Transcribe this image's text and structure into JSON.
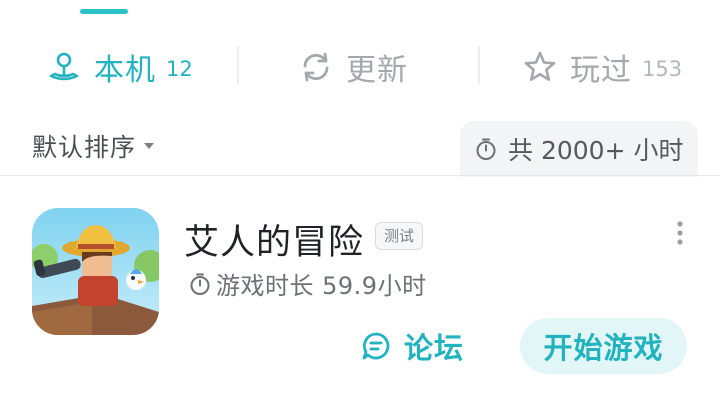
{
  "colors": {
    "accent": "#22b3bf",
    "inactive": "#a3a8ad"
  },
  "tabs": [
    {
      "label": "本机",
      "count": "12",
      "icon": "joystick-icon",
      "active": true
    },
    {
      "label": "更新",
      "icon": "refresh-icon",
      "active": false
    },
    {
      "label": "玩过",
      "count": "153",
      "icon": "star-icon",
      "active": false
    }
  ],
  "sort": {
    "label": "默认排序"
  },
  "total_time": {
    "text": "共 2000+ 小时",
    "icon": "timer-icon"
  },
  "game": {
    "title": "艾人的冒险",
    "tag": "测试",
    "play_time": "游戏时长 59.9小时",
    "forum_label": "论坛",
    "start_label": "开始游戏"
  }
}
